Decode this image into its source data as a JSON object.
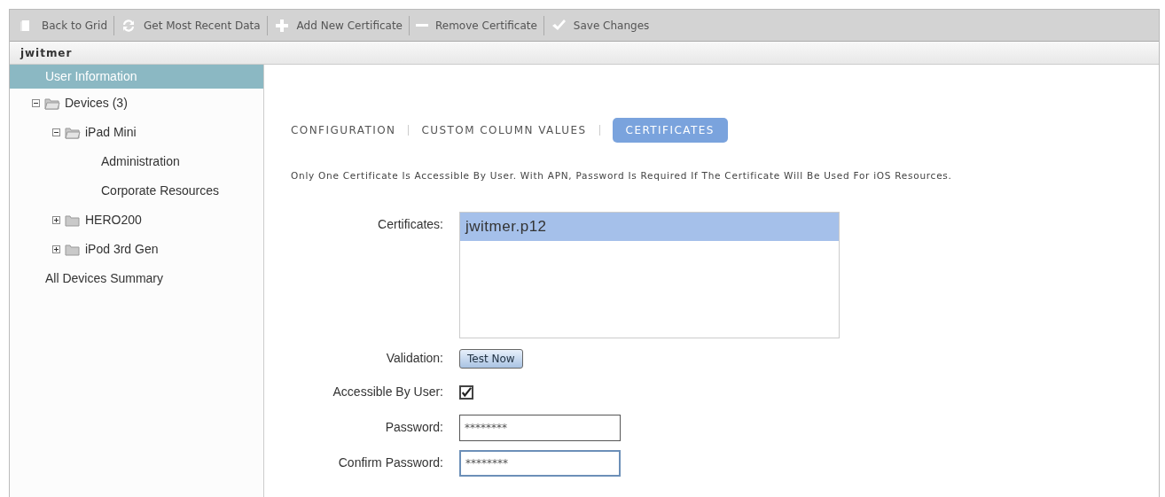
{
  "toolbar": [
    {
      "kind": "back",
      "label": "Back to Grid"
    },
    {
      "kind": "refresh",
      "label": "Get Most Recent Data"
    },
    {
      "kind": "add",
      "label": "Add New Certificate"
    },
    {
      "kind": "remove",
      "label": "Remove Certificate"
    },
    {
      "kind": "save",
      "label": "Save Changes"
    }
  ],
  "user": "jwitmer",
  "sidebar": {
    "items": [
      {
        "label": "User Information",
        "selected": true
      },
      {
        "label": "Devices (3)",
        "selected": false,
        "expanded": true,
        "children": [
          {
            "label": "iPad Mini",
            "selected": false,
            "expanded": true,
            "children": [
              {
                "label": "Administration",
                "selected": false
              },
              {
                "label": "Corporate Resources",
                "selected": false
              }
            ]
          },
          {
            "label": "HERO200",
            "selected": false,
            "expanded": false
          },
          {
            "label": "iPod 3rd Gen",
            "selected": false,
            "expanded": false
          }
        ]
      },
      {
        "label": "All Devices Summary",
        "selected": false
      }
    ]
  },
  "tabs": [
    {
      "label": "CONFIGURATION",
      "selected": false
    },
    {
      "label": "CUSTOM COLUMN VALUES",
      "selected": false
    },
    {
      "label": "CERTIFICATES",
      "selected": true
    }
  ],
  "description": "Only One Certificate Is Accessible By User. With APN, Password Is Required If The Certificate Will Be Used For iOS Resources.",
  "form": {
    "certificates_label": "Certificates:",
    "certificates": [
      {
        "label": "jwitmer.p12",
        "selected": true
      }
    ],
    "validation_label": "Validation:",
    "test_button": "Test Now",
    "accessible_label": "Accessible By User:",
    "accessible": true,
    "password_label": "Password:",
    "password": "********",
    "focused": false,
    "confirm_label": "Confirm Password:",
    "confirm": "********",
    "confirm_focused": true
  }
}
